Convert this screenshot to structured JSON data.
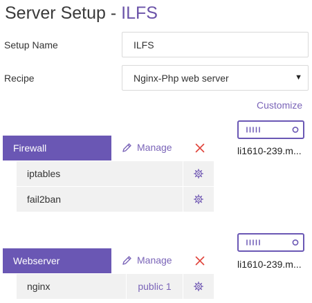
{
  "header": {
    "title_prefix": "Server Setup - ",
    "title_project": "ILFS"
  },
  "form": {
    "setup_name_label": "Setup Name",
    "setup_name_value": "ILFS",
    "recipe_label": "Recipe",
    "recipe_value": "Nginx-Php web server",
    "customize_label": "Customize"
  },
  "groups": [
    {
      "name": "Firewall",
      "manage_label": "Manage",
      "services": [
        {
          "name": "iptables",
          "tag": ""
        },
        {
          "name": "fail2ban",
          "tag": ""
        }
      ],
      "server_label": "li1610-239.m..."
    },
    {
      "name": "Webserver",
      "manage_label": "Manage",
      "services": [
        {
          "name": "nginx",
          "tag": "public 1"
        }
      ],
      "server_label": "li1610-239.m..."
    }
  ],
  "colors": {
    "accent": "#6a57b4",
    "link": "#7a64b8",
    "danger": "#e0433a",
    "row_bg": "#f1f1f1"
  },
  "icons": [
    "pencil-icon",
    "close-icon",
    "gear-icon",
    "server-icon",
    "chevron-down-icon"
  ]
}
